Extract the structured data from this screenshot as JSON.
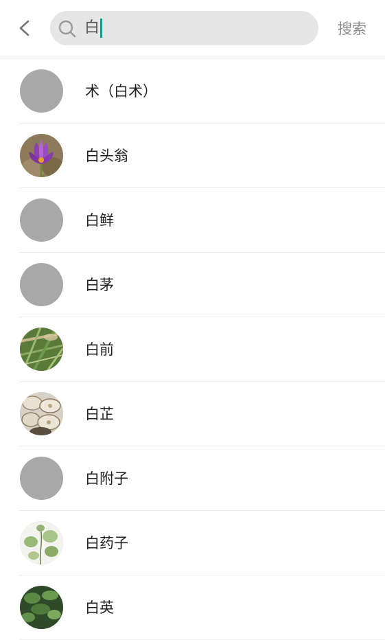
{
  "header": {
    "search_query": "白",
    "submit_label": "搜索",
    "back_icon": "chevron-left-icon",
    "search_icon": "magnifier-icon"
  },
  "results": [
    {
      "name": "术（白术）",
      "thumb": "placeholder"
    },
    {
      "name": "白头翁",
      "thumb": "purple-flower"
    },
    {
      "name": "白鲜",
      "thumb": "placeholder"
    },
    {
      "name": "白茅",
      "thumb": "placeholder"
    },
    {
      "name": "白前",
      "thumb": "green-grass"
    },
    {
      "name": "白芷",
      "thumb": "dried-slices"
    },
    {
      "name": "白附子",
      "thumb": "placeholder"
    },
    {
      "name": "白药子",
      "thumb": "leafy-vine"
    },
    {
      "name": "白英",
      "thumb": "green-leaves"
    }
  ],
  "colors": {
    "caret": "#1a9a8a",
    "search_bg": "#e6e6e6",
    "placeholder_avatar": "#a8a8a8"
  }
}
